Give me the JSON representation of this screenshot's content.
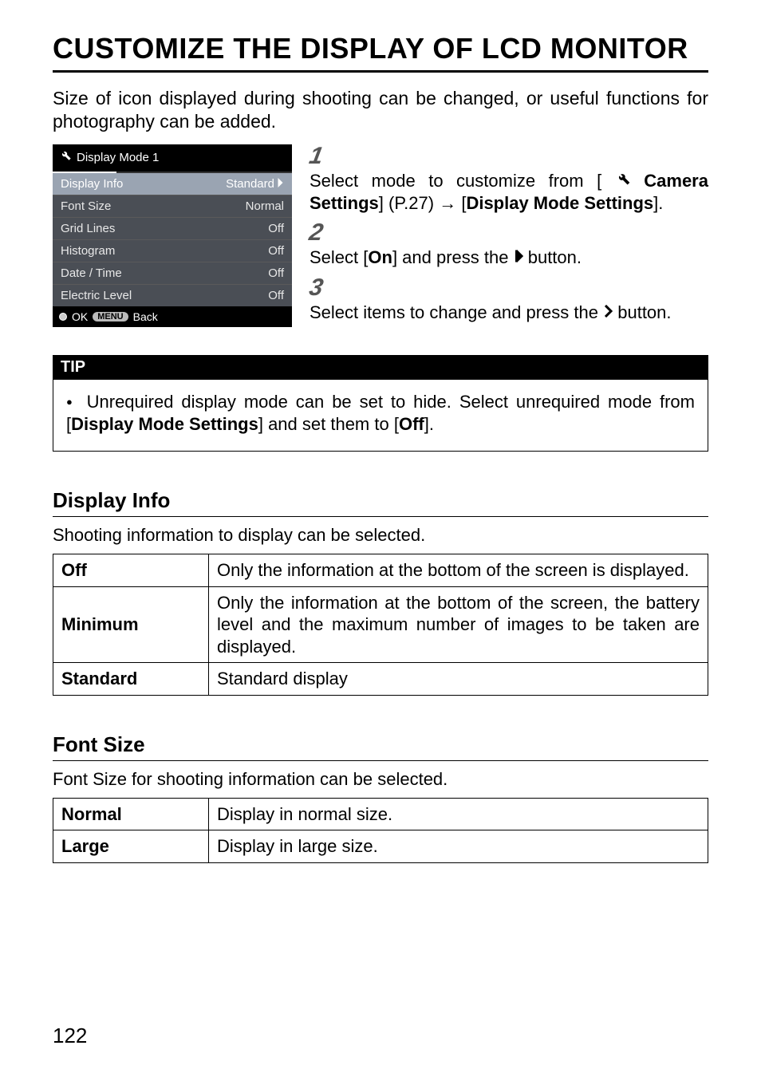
{
  "title": "CUSTOMIZE THE DISPLAY OF LCD MONITOR",
  "intro": "Size of icon displayed during shooting can be changed, or useful functions for photography can be added.",
  "lcd": {
    "header_icon": "wrench-icon",
    "header_title": "Display Mode 1",
    "rows": [
      {
        "label": "Display Info",
        "value": "Standard",
        "has_chevron": true,
        "selected": true
      },
      {
        "label": "Font Size",
        "value": "Normal",
        "has_chevron": false,
        "selected": false
      },
      {
        "label": "Grid Lines",
        "value": "Off",
        "has_chevron": false,
        "selected": false
      },
      {
        "label": "Histogram",
        "value": "Off",
        "has_chevron": false,
        "selected": false
      },
      {
        "label": "Date / Time",
        "value": "Off",
        "has_chevron": false,
        "selected": false
      },
      {
        "label": "Electric Level",
        "value": "Off",
        "has_chevron": false,
        "selected": false
      }
    ],
    "footer": {
      "ok": "OK",
      "menu_pill": "MENU",
      "back": "Back"
    }
  },
  "steps": {
    "s1": {
      "num": "1",
      "pre": "Select mode to customize from [",
      "bold1": "Camera Settings",
      "mid1": "] (P.27) → [",
      "bold2": "Display Mode Settings",
      "post": "]."
    },
    "s2": {
      "num": "2",
      "pre": "Select [",
      "bold1": "On",
      "mid1": "] and press the ",
      "post": "button."
    },
    "s3": {
      "num": "3",
      "pre": "Select items to change and press the ",
      "post": " button."
    }
  },
  "tip": {
    "heading": "TIP",
    "text_pre": "Unrequired display mode can be set to hide. Select unrequired mode from [",
    "bold1": "Display Mode Settings",
    "mid1": "] and set them to [",
    "bold2": "Off",
    "post": "]."
  },
  "display_info": {
    "heading": "Display Info",
    "desc": "Shooting information to display can be selected.",
    "rows": [
      {
        "k": "Off",
        "d": "Only the information at the bottom of the screen is displayed."
      },
      {
        "k": "Minimum",
        "d": "Only the information at the bottom of the screen, the battery level and the maximum number of images to be taken are displayed."
      },
      {
        "k": "Standard",
        "d": "Standard display"
      }
    ]
  },
  "font_size": {
    "heading": "Font Size",
    "desc": "Font Size for shooting information can be selected.",
    "rows": [
      {
        "k": "Normal",
        "d": "Display in normal size."
      },
      {
        "k": "Large",
        "d": "Display in large size."
      }
    ]
  },
  "page_number": "122"
}
